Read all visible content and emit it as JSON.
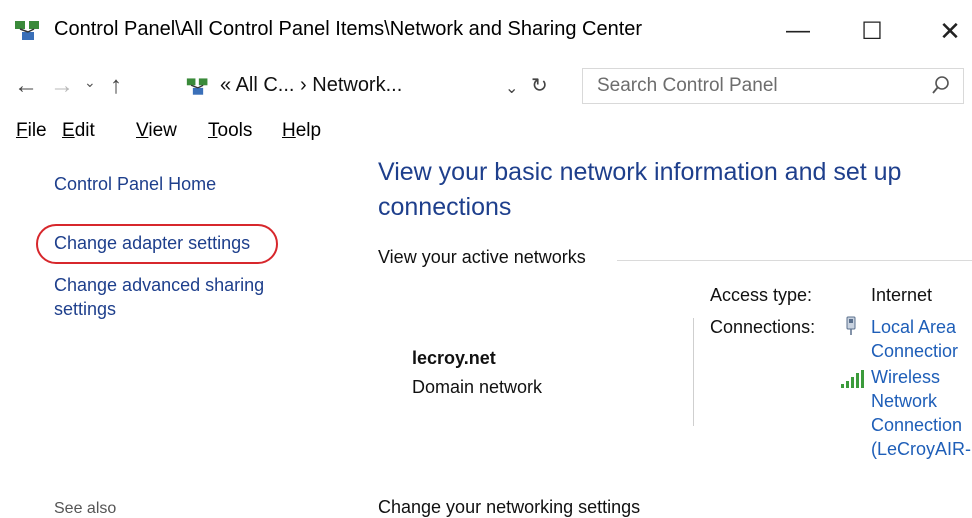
{
  "window": {
    "title": "Control Panel\\All Control Panel Items\\Network and Sharing Center",
    "minimize_glyph": "—",
    "maximize_glyph": "☐",
    "close_glyph": "✕"
  },
  "nav": {
    "back_glyph": "←",
    "forward_glyph": "→",
    "recent_glyph": "⌄",
    "up_glyph": "↑",
    "address": "« All C... › Network...",
    "address_dropdown_glyph": "⌄",
    "refresh_glyph": "↻",
    "search_placeholder": "Search Control Panel"
  },
  "menu": {
    "items": [
      {
        "key": "F",
        "rest": "ile"
      },
      {
        "key": "E",
        "rest": "dit"
      },
      {
        "key": "V",
        "rest": "iew"
      },
      {
        "key": "T",
        "rest": "ools"
      },
      {
        "key": "H",
        "rest": "elp"
      }
    ]
  },
  "left_nav": {
    "home": "Control Panel Home",
    "adapter": "Change adapter settings",
    "advanced_sharing": "Change advanced sharing settings",
    "see_also_partial": "See also"
  },
  "main": {
    "heading": "View your basic network information and set up connections",
    "active_networks_label": "View your active networks",
    "network": {
      "name": "lecroy.net",
      "category": "Domain network",
      "access_type_label": "Access type:",
      "access_type_value": "Internet",
      "connections_label": "Connections:",
      "connection_1": "Local Area\nConnectior",
      "connection_2": "Wireless\nNetwork\nConnection\n(LeCroyAIR-"
    },
    "change_settings_label": "Change your networking settings"
  },
  "colors": {
    "link": "#1e3f8c",
    "connection_link": "#1e5eb8",
    "highlight": "#d7272c"
  }
}
